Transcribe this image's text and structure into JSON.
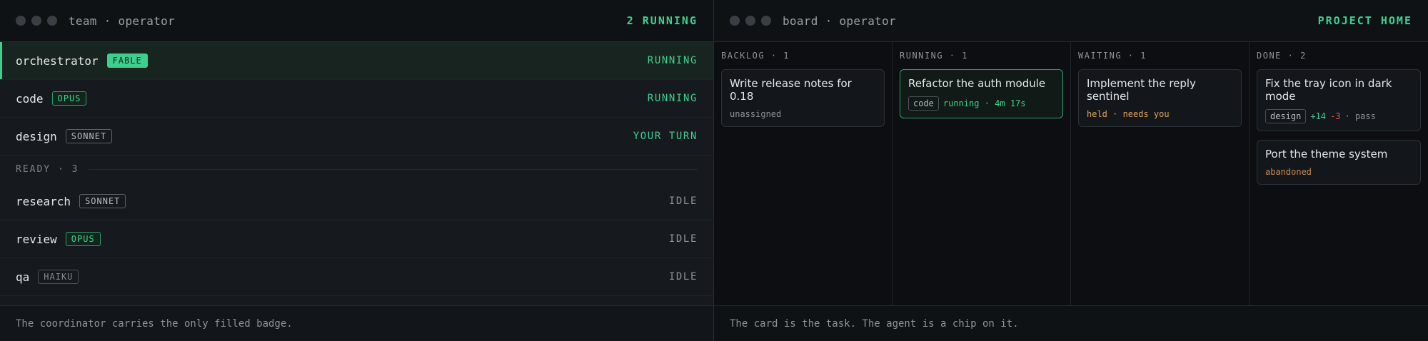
{
  "left": {
    "title": "team · operator",
    "status": "2 RUNNING",
    "agents": [
      {
        "name": "orchestrator",
        "model": "FABLE",
        "state": "RUNNING"
      },
      {
        "name": "code",
        "model": "OPUS",
        "state": "RUNNING"
      },
      {
        "name": "design",
        "model": "SONNET",
        "state": "YOUR TURN"
      }
    ],
    "ready_section": "READY · 3",
    "ready": [
      {
        "name": "research",
        "model": "SONNET",
        "state": "IDLE"
      },
      {
        "name": "review",
        "model": "OPUS",
        "state": "IDLE"
      },
      {
        "name": "qa",
        "model": "HAIKU",
        "state": "IDLE"
      }
    ],
    "footer": "The coordinator carries the only filled badge."
  },
  "right": {
    "title": "board · operator",
    "status": "PROJECT HOME",
    "columns": [
      {
        "head": "BACKLOG · 1",
        "cards": [
          {
            "title": "Write release notes for 0.18",
            "meta": "unassigned"
          }
        ]
      },
      {
        "head": "RUNNING · 1",
        "cards": [
          {
            "title": "Refactor the auth module",
            "chip": "code",
            "meta": "running · 4m 17s"
          }
        ]
      },
      {
        "head": "WAITING · 1",
        "cards": [
          {
            "title": "Implement the reply sentinel",
            "meta": "held · needs you"
          }
        ]
      },
      {
        "head": "DONE · 2",
        "cards": [
          {
            "title": "Fix the tray icon in dark mode",
            "chip": "design",
            "plus": "+14",
            "minus": "-3",
            "meta": "· pass"
          },
          {
            "title": "Port the theme system",
            "meta": "abandoned"
          }
        ]
      }
    ],
    "footer": "The card is the task. The agent is a chip on it."
  }
}
